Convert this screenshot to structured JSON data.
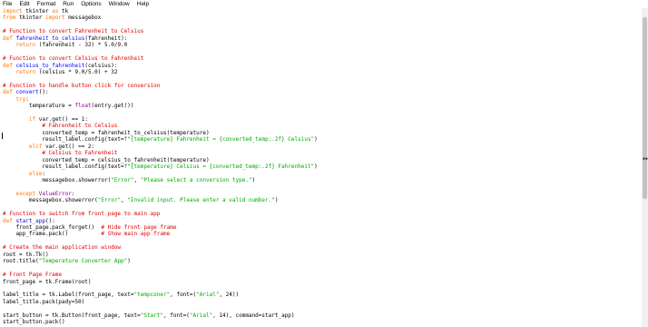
{
  "menu": [
    "File",
    "Edit",
    "Format",
    "Run",
    "Options",
    "Window",
    "Help"
  ],
  "editor": {
    "lines": [
      [
        [
          "kw",
          "import"
        ],
        [
          "n",
          " tkinter "
        ],
        [
          "kw",
          "as"
        ],
        [
          "n",
          " tk"
        ]
      ],
      [
        [
          "kw",
          "from"
        ],
        [
          "n",
          " tkinter "
        ],
        [
          "kw",
          "import"
        ],
        [
          "n",
          " messagebox"
        ]
      ],
      [],
      [
        [
          "cm",
          "# Function to convert Fahrenheit to Celsius"
        ]
      ],
      [
        [
          "kw",
          "def"
        ],
        [
          "n",
          " "
        ],
        [
          "df",
          "fahrenheit_to_celsius"
        ],
        [
          "n",
          "(fahrenheit):"
        ]
      ],
      [
        [
          "n",
          "    "
        ],
        [
          "kw",
          "return"
        ],
        [
          "n",
          " (fahrenheit - 32) * 5.0/9.0"
        ]
      ],
      [],
      [
        [
          "cm",
          "# Function to convert Celsius to Fahrenheit"
        ]
      ],
      [
        [
          "kw",
          "def"
        ],
        [
          "n",
          " "
        ],
        [
          "df",
          "celsius_to_fahrenheit"
        ],
        [
          "n",
          "(celsius):"
        ]
      ],
      [
        [
          "n",
          "    "
        ],
        [
          "kw",
          "return"
        ],
        [
          "n",
          " (celsius * 9.0/5.0) + 32"
        ]
      ],
      [],
      [
        [
          "cm",
          "# Function to handle button click for conversion"
        ]
      ],
      [
        [
          "kw",
          "def"
        ],
        [
          "n",
          " "
        ],
        [
          "df",
          "convert"
        ],
        [
          "n",
          "():"
        ]
      ],
      [
        [
          "n",
          "    "
        ],
        [
          "kw",
          "try"
        ],
        [
          "n",
          ":"
        ]
      ],
      [
        [
          "n",
          "        temperature = "
        ],
        [
          "bi",
          "float"
        ],
        [
          "n",
          "(entry.get())"
        ]
      ],
      [],
      [
        [
          "n",
          "        "
        ],
        [
          "kw",
          "if"
        ],
        [
          "n",
          " var.get() == 1:"
        ]
      ],
      [
        [
          "n",
          "            "
        ],
        [
          "cm",
          "# Fahrenheit to Celsius"
        ]
      ],
      [
        [
          "n",
          "            converted_temp = fahrenheit_to_celsius(temperature)"
        ]
      ],
      [
        [
          "n",
          "            result_label.config(text="
        ],
        [
          "str",
          "f\"{temperature} Fahrenheit = {converted_temp:.2f} Celsius\""
        ],
        [
          "n",
          ")"
        ]
      ],
      [
        [
          "n",
          "        "
        ],
        [
          "kw",
          "elif"
        ],
        [
          "n",
          " var.get() == 2:"
        ]
      ],
      [
        [
          "n",
          "            "
        ],
        [
          "cm",
          "# Celsius to Fahrenheit"
        ]
      ],
      [
        [
          "n",
          "            converted_temp = celsius_to_fahrenheit(temperature)"
        ]
      ],
      [
        [
          "n",
          "            result_label.config(text="
        ],
        [
          "str",
          "f\"{temperature} Celsius = {converted_temp:.2f} Fahrenheit\""
        ],
        [
          "n",
          ")"
        ]
      ],
      [
        [
          "n",
          "        "
        ],
        [
          "kw",
          "else"
        ],
        [
          "n",
          ":"
        ]
      ],
      [
        [
          "n",
          "            messagebox.showerror("
        ],
        [
          "str",
          "\"Error\""
        ],
        [
          "n",
          ", "
        ],
        [
          "str",
          "\"Please select a conversion type.\""
        ],
        [
          "n",
          ")"
        ]
      ],
      [],
      [
        [
          "n",
          "    "
        ],
        [
          "kw",
          "except"
        ],
        [
          "n",
          " "
        ],
        [
          "bi",
          "ValueError"
        ],
        [
          "n",
          ":"
        ]
      ],
      [
        [
          "n",
          "        messagebox.showerror("
        ],
        [
          "str",
          "\"Error\""
        ],
        [
          "n",
          ", "
        ],
        [
          "str",
          "\"Invalid input. Please enter a valid number.\""
        ],
        [
          "n",
          ")"
        ]
      ],
      [],
      [
        [
          "cm",
          "# Function to switch from front page to main app"
        ]
      ],
      [
        [
          "kw",
          "def"
        ],
        [
          "n",
          " "
        ],
        [
          "df",
          "start_app"
        ],
        [
          "n",
          "():"
        ]
      ],
      [
        [
          "n",
          "    front_page.pack_forget()  "
        ],
        [
          "cm",
          "# Hide front page frame"
        ]
      ],
      [
        [
          "n",
          "    app_frame.pack()          "
        ],
        [
          "cm",
          "# Show main app frame"
        ]
      ],
      [],
      [
        [
          "cm",
          "# Create the main application window"
        ]
      ],
      [
        [
          "n",
          "root = tk.Tk()"
        ]
      ],
      [
        [
          "n",
          "root.title("
        ],
        [
          "str",
          "\"Temperature Converter App\""
        ],
        [
          "n",
          ")"
        ]
      ],
      [],
      [
        [
          "cm",
          "# Front Page Frame"
        ]
      ],
      [
        [
          "n",
          "front_page = tk.Frame(root)"
        ]
      ],
      [],
      [
        [
          "n",
          "label_title = tk.Label(front_page, text="
        ],
        [
          "str",
          "\"tempconer\""
        ],
        [
          "n",
          ", font=("
        ],
        [
          "str",
          "\"Arial\""
        ],
        [
          "n",
          ", 24))"
        ]
      ],
      [
        [
          "n",
          "label_title.pack(pady=50)"
        ]
      ],
      [],
      [
        [
          "n",
          "start_button = tk.Button(front_page, text="
        ],
        [
          "str",
          "\"Start\""
        ],
        [
          "n",
          ", font=("
        ],
        [
          "str",
          "\"Arial\""
        ],
        [
          "n",
          ", 14), command=start_app)"
        ]
      ],
      [
        [
          "n",
          "start_button.pack()"
        ]
      ]
    ]
  },
  "colors": {
    "keyword": "#ff7700",
    "builtin": "#900090",
    "string": "#00aa00",
    "comment": "#dd0000",
    "definition": "#0000ff"
  },
  "icons": {
    "mouse_cursor": "resize-horizontal-cursor-icon"
  }
}
